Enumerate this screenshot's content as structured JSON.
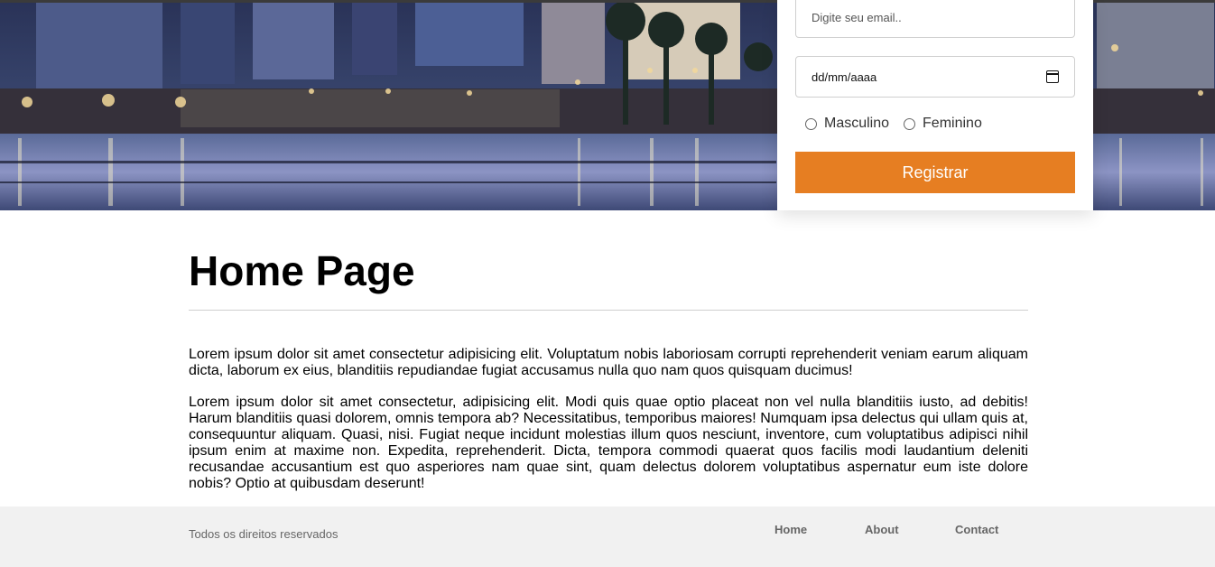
{
  "form": {
    "email_placeholder": "Digite seu email..",
    "date_value": "dd/mm/aaaa",
    "gender_options": [
      "Masculino",
      "Feminino"
    ],
    "submit_label": "Registrar"
  },
  "main": {
    "title": "Home Page",
    "paragraphs": [
      "Lorem ipsum dolor sit amet consectetur adipisicing elit. Voluptatum nobis laboriosam corrupti reprehenderit veniam earum aliquam dicta, laborum ex eius, blanditiis repudiandae fugiat accusamus nulla quo nam quos quisquam ducimus!",
      "Lorem ipsum dolor sit amet consectetur, adipisicing elit. Modi quis quae optio placeat non vel nulla blanditiis iusto, ad debitis! Harum blanditiis quasi dolorem, omnis tempora ab? Necessitatibus, temporibus maiores! Numquam ipsa delectus qui ullam quis at, consequuntur aliquam. Quasi, nisi. Fugiat neque incidunt molestias illum quos nesciunt, inventore, cum voluptatibus adipisci nihil ipsum enim at maxime non. Expedita, reprehenderit. Dicta, tempora commodi quaerat quos facilis modi laudantium deleniti recusandae accusantium est quo asperiores nam quae sint, quam delectus dolorem voluptatibus aspernatur eum iste dolore nobis? Optio at quibusdam deserunt!"
    ]
  },
  "footer": {
    "copyright": "Todos os direitos reservados",
    "nav": [
      "Home",
      "About",
      "Contact"
    ]
  },
  "colors": {
    "accent": "#e67e22",
    "footer_bg": "#f1f1f1"
  },
  "icons": {
    "date_picker": "calendar-icon"
  }
}
